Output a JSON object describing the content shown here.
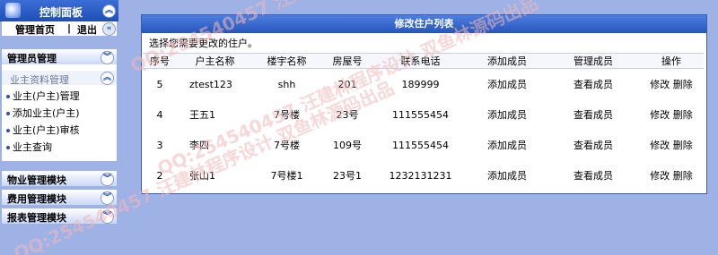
{
  "sidebar": {
    "header_title": "控制面板",
    "quick_links": [
      "管理首页",
      "|",
      "退出"
    ],
    "panel": {
      "title": "管理员管理",
      "sub_title": "业主资料管理",
      "items": [
        "业主(户主)管理",
        "添加业主(户主)",
        "业主(户主)审核",
        "业主查询"
      ]
    },
    "modules": [
      "物业管理模块",
      "费用管理模块",
      "报表管理模块"
    ]
  },
  "main": {
    "title": "修改住户列表",
    "hint": "选择您需要更改的住户。",
    "columns": [
      "序号",
      "户主名称",
      "楼宇名称",
      "房屋号",
      "联系电话",
      "添加成员",
      "管理成员",
      "操作"
    ],
    "rows": [
      {
        "no": "5",
        "owner": "ztest123",
        "building": "shh",
        "room": "201",
        "phone": "189999",
        "add": "添加成员",
        "manage": "查看成员",
        "edit": "修改",
        "del": "删除"
      },
      {
        "no": "4",
        "owner": "王五1",
        "building": "7号楼",
        "room": "23号",
        "phone": "111555454",
        "add": "添加成员",
        "manage": "查看成员",
        "edit": "修改",
        "del": "删除"
      },
      {
        "no": "3",
        "owner": "李四",
        "building": "7号楼",
        "room": "109号",
        "phone": "111555454",
        "add": "添加成员",
        "manage": "查看成员",
        "edit": "修改",
        "del": "删除"
      },
      {
        "no": "2",
        "owner": "张山1",
        "building": "7号楼1",
        "room": "23号1",
        "phone": "1232131231",
        "add": "添加成员",
        "manage": "查看成员",
        "edit": "修改",
        "del": "删除"
      }
    ]
  },
  "watermark": "QQ:254540457 汪建林程序设计 双鱼林源码出品"
}
